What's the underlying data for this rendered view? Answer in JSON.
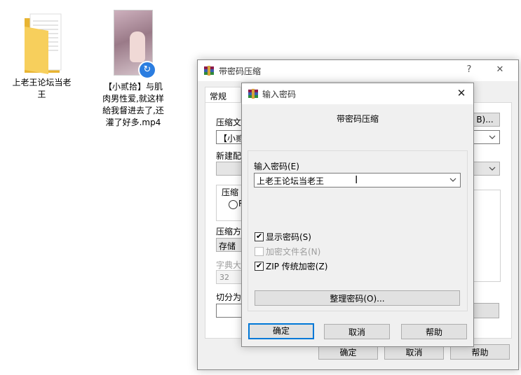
{
  "desktop": {
    "folder_label": "上老王论坛当老\n王",
    "video_label": "【小贰拾】与肌\n肉男性爱,就这样\n給我督进去了,还\n灌了好多.mp4"
  },
  "bg_dialog": {
    "title": "带密码压缩",
    "help_btn": "?",
    "close_btn": "✕",
    "tab_general": "常规",
    "lbl_archive_name": "压缩文",
    "archive_name_value": "【小贰",
    "browse_btn": "B)...",
    "lbl_new_config": "新建配",
    "lbl_archive_group": "压缩",
    "radio_label": "R",
    "lbl_method": "压缩方",
    "method_value": "存储",
    "lbl_dict": "字典大",
    "dict_value": "32",
    "lbl_split": "切分为",
    "ok_btn": "确定",
    "cancel_btn": "取消",
    "help_text_btn": "帮助"
  },
  "password_dialog": {
    "title": "输入密码",
    "close_btn": "✕",
    "heading": "带密码压缩",
    "password_label": "输入密码(E)",
    "password_value": "上老王论坛当老王",
    "show_password_label": "显示密码(S)",
    "show_password_checked": true,
    "encrypt_names_label": "加密文件名(N)",
    "encrypt_names_checked": false,
    "zip_legacy_label": "ZIP 传统加密(Z)",
    "zip_legacy_checked": true,
    "organize_btn": "整理密码(O)...",
    "ok_btn": "确定",
    "cancel_btn": "取消",
    "help_btn": "帮助"
  },
  "colors": {
    "accent": "#0078d7",
    "dialog_bg": "#f0f0f0",
    "folder_yellow": "#f5c342"
  }
}
